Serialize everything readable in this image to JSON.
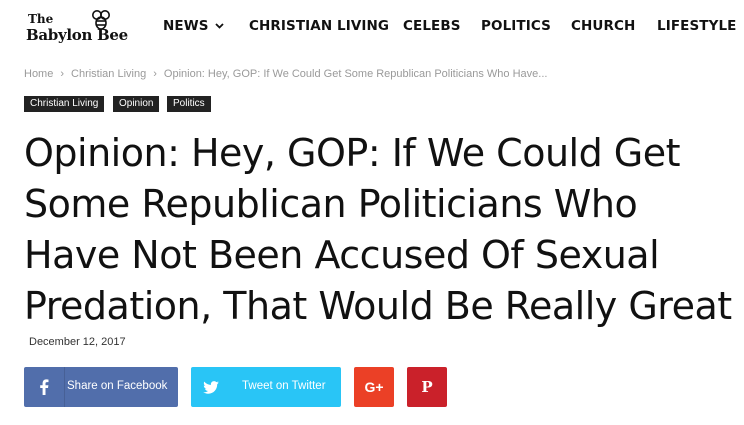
{
  "logo": {
    "line1": "The",
    "line2": "Babylon Bee"
  },
  "nav": {
    "items": [
      "NEWS",
      "CHRISTIAN LIVING",
      "CELEBS",
      "POLITICS",
      "CHURCH",
      "LIFESTYLE"
    ]
  },
  "breadcrumb": {
    "home": "Home",
    "category": "Christian Living",
    "current": "Opinion: Hey, GOP: If We Could Get Some Republican Politicians Who Have...",
    "separator": "›"
  },
  "tags": [
    "Christian Living",
    "Opinion",
    "Politics"
  ],
  "article": {
    "title_lines": [
      "Opinion: Hey, GOP: If We Could Get",
      "Some Republican Politicians Who",
      "Have Not Been Accused Of Sexual",
      "Predation, That Would Be Really Great"
    ],
    "date": "December 12, 2017"
  },
  "share": {
    "facebook": "Share on Facebook",
    "twitter": "Tweet on Twitter",
    "googleplus": "G+",
    "pinterest": "P"
  },
  "colors": {
    "facebook": "#516eab",
    "twitter": "#29c5f6",
    "googleplus": "#eb4026",
    "pinterest": "#ca212a",
    "tag_bg": "#222222"
  }
}
